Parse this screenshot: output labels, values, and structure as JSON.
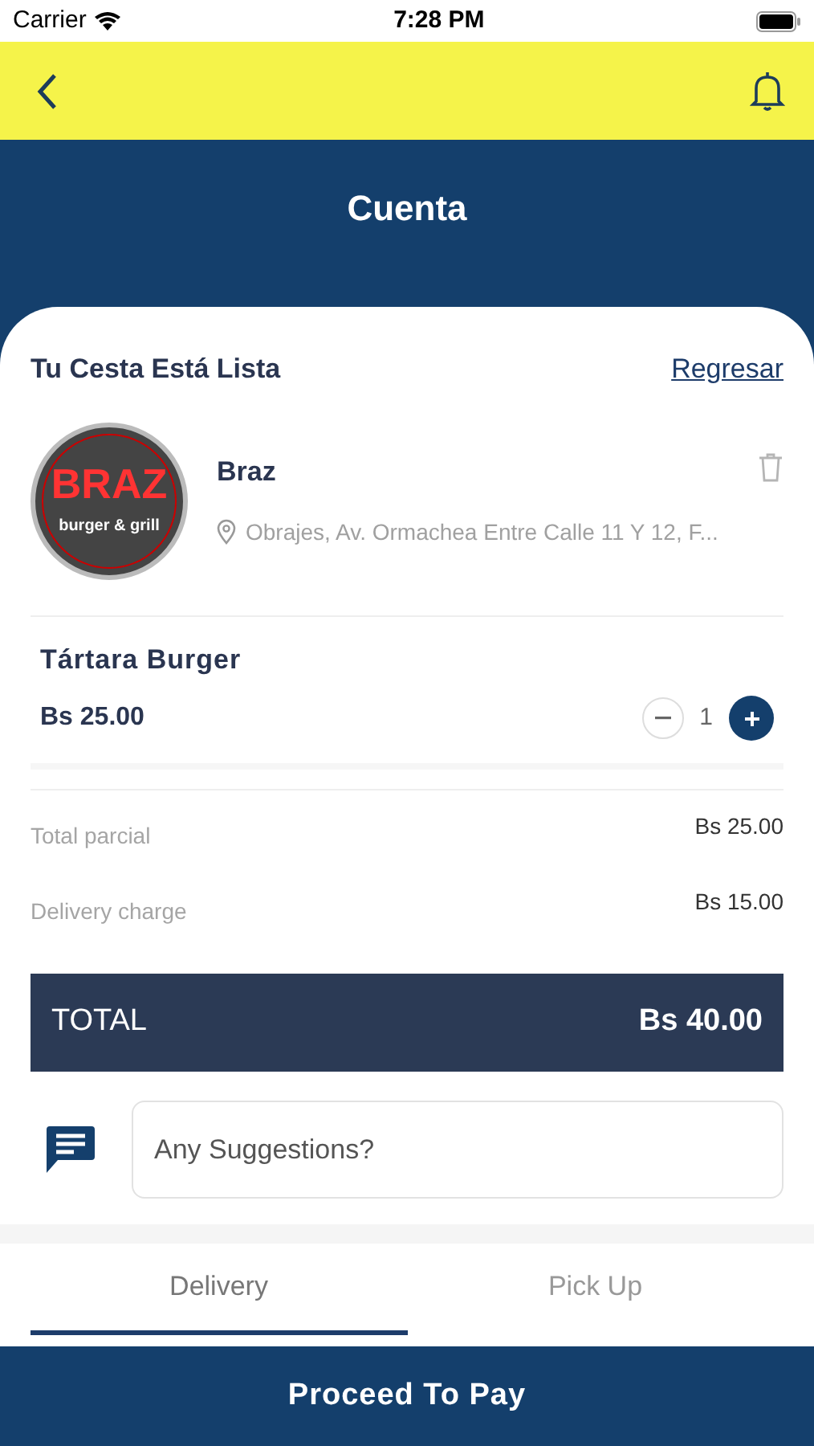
{
  "status_bar": {
    "carrier": "Carrier",
    "time": "7:28 PM"
  },
  "header": {
    "title": "Cuenta"
  },
  "basket": {
    "heading": "Tu Cesta Está Lista",
    "back_link": "Regresar"
  },
  "restaurant": {
    "logo_title": "BRAZ",
    "logo_subtitle": "burger & grill",
    "name": "Braz",
    "address": "Obrajes, Av. Ormachea Entre Calle 11 Y 12, F..."
  },
  "items": [
    {
      "name": "Tártara Burger",
      "price": "Bs 25.00",
      "quantity": "1"
    }
  ],
  "summary": [
    {
      "label": "Total parcial",
      "value": "Bs 25.00"
    },
    {
      "label": "Delivery charge",
      "value": "Bs 15.00"
    }
  ],
  "total": {
    "label": "TOTAL",
    "value": "Bs 40.00"
  },
  "suggestions": {
    "placeholder": "Any Suggestions?"
  },
  "tabs": [
    {
      "label": "Delivery",
      "selected": true
    },
    {
      "label": "Pick Up",
      "selected": false
    }
  ],
  "pay_button": "Proceed To Pay"
}
